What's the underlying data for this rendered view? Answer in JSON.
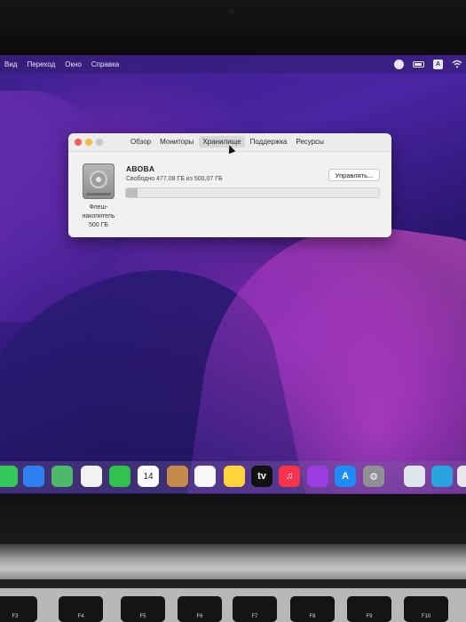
{
  "menubar": {
    "items": [
      "Вид",
      "Переход",
      "Окно",
      "Справка"
    ],
    "right_icons": [
      "screen-record-icon",
      "battery-icon",
      "keyboard-input-icon",
      "wifi-icon"
    ],
    "input_label": "A"
  },
  "window": {
    "tabs": [
      "Обзор",
      "Мониторы",
      "Хранилище",
      "Поддержка",
      "Ресурсы"
    ],
    "active_tab": "Хранилище",
    "volume_name": "ABOBA",
    "free_text": "Свободно 477,08 ГБ из 500,07 ГБ",
    "manage_label": "Управлять...",
    "disk_label_lines": [
      "Флеш-",
      "накопитель",
      "500 ГБ"
    ],
    "used_fraction": 0.046
  },
  "dock": {
    "apps": [
      {
        "name": "messages",
        "color": "#34c759",
        "glyph": ""
      },
      {
        "name": "mail",
        "color": "#2f7ff0",
        "glyph": ""
      },
      {
        "name": "maps",
        "color": "#4fb96a",
        "glyph": ""
      },
      {
        "name": "photos",
        "color": "#f2f2f2",
        "glyph": ""
      },
      {
        "name": "facetime",
        "color": "#2fc24f",
        "glyph": ""
      },
      {
        "name": "calendar",
        "color": "#ffffff",
        "glyph": "14"
      },
      {
        "name": "contacts",
        "color": "#c58a4c",
        "glyph": ""
      },
      {
        "name": "reminders",
        "color": "#f7f7f7",
        "glyph": ""
      },
      {
        "name": "notes",
        "color": "#ffd43b",
        "glyph": ""
      },
      {
        "name": "tv",
        "color": "#111111",
        "glyph": "tv"
      },
      {
        "name": "music",
        "color": "#f8344d",
        "glyph": "♫"
      },
      {
        "name": "podcasts",
        "color": "#9a3ce0",
        "glyph": ""
      },
      {
        "name": "app-store",
        "color": "#1d8cf7",
        "glyph": "A"
      },
      {
        "name": "system-preferences",
        "color": "#8e8e93",
        "glyph": "⚙"
      },
      {
        "name": "preview",
        "color": "#dfe6ee",
        "glyph": ""
      },
      {
        "name": "telegram",
        "color": "#2aa3e0",
        "glyph": ""
      },
      {
        "name": "downloads",
        "color": "#e8e8ea",
        "glyph": ""
      }
    ],
    "calendar_month": "НОЯБ."
  },
  "keyboard": {
    "keys": [
      "F3",
      "F4",
      "F5",
      "F6",
      "F7",
      "F8",
      "F9",
      "F10"
    ]
  }
}
